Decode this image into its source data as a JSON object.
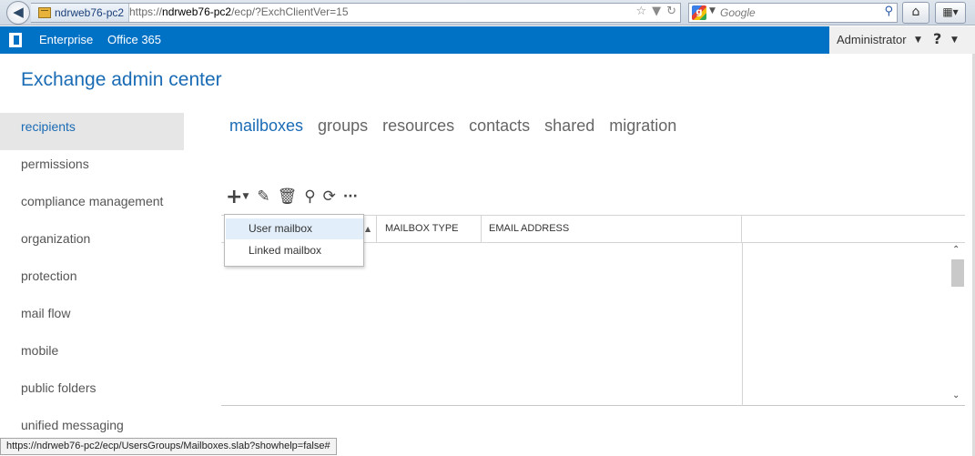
{
  "browser": {
    "site_name": "ndrweb76-pc2",
    "url_prefix": "https://",
    "url_host": "ndrweb76-pc2",
    "url_path": "/ecp/?ExchClientVer=15",
    "search_placeholder": "Google",
    "status_url": "https://ndrweb76-pc2/ecp/UsersGroups/Mailboxes.slab?showhelp=false#"
  },
  "suite_bar": {
    "links": [
      "Enterprise",
      "Office 365"
    ],
    "user": "Administrator",
    "help": "?",
    "accent": "#0072c6"
  },
  "app_title": "Exchange admin center",
  "nav": {
    "items": [
      "recipients",
      "permissions",
      "compliance management",
      "organization",
      "protection",
      "mail flow",
      "mobile",
      "public folders",
      "unified messaging"
    ],
    "active": "recipients"
  },
  "tabs": {
    "items": [
      "mailboxes",
      "groups",
      "resources",
      "contacts",
      "shared",
      "migration"
    ],
    "active": "mailboxes"
  },
  "toolbar": {
    "icons": [
      "plus-icon",
      "pencil-icon",
      "trash-icon",
      "search-icon",
      "refresh-icon",
      "more-icon"
    ]
  },
  "grid": {
    "columns": [
      "MAILBOX TYPE",
      "EMAIL ADDRESS"
    ]
  },
  "new_menu": {
    "items": [
      "User mailbox",
      "Linked mailbox"
    ],
    "hovered": "User mailbox"
  }
}
